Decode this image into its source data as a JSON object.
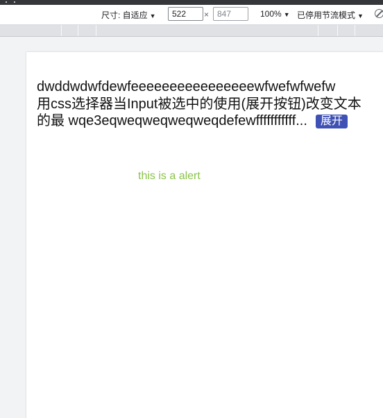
{
  "toolbar": {
    "size_label": "尺寸: 自适应",
    "width_value": "522",
    "height_value": "847",
    "times_symbol": "×",
    "zoom_label": "100%",
    "throttle_label": "已停用节流模式",
    "caret": "▼"
  },
  "content": {
    "line1": "dwddwdwfdewfeeeeeeeeeeeeeeeewfwefwfwefw",
    "line2": "用css选择器当Input被选中的使用(展开按钮)改变文本",
    "line3": "的最  wqe3eqweqweqweqweqdefewfffffffffff...",
    "expand_button": "展开",
    "alert_text": "this is a alert"
  },
  "colors": {
    "expand_button_bg": "#3f51b5",
    "alert_text": "#8bc34a"
  }
}
